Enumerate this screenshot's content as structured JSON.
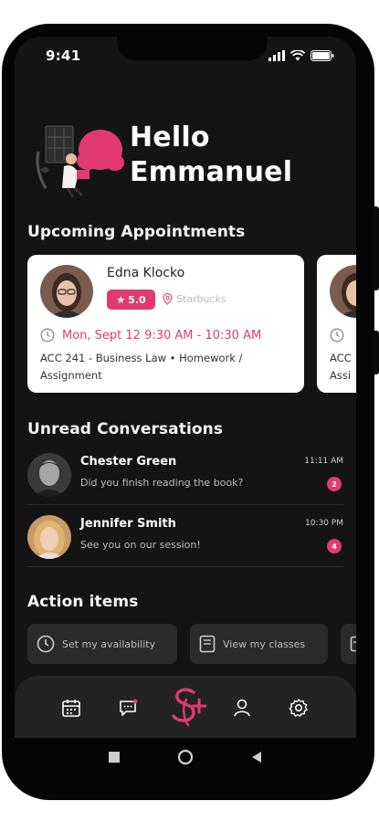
{
  "status_bar": {
    "time": "9:41"
  },
  "greeting": {
    "line1": "Hello",
    "line2": "Emmanuel"
  },
  "sections": {
    "appointments": "Upcoming Appointments",
    "unread": "Unread Conversations",
    "actions": "Action items"
  },
  "appointment": {
    "name": "Edna Klocko",
    "rating": "5.0",
    "location": "Starbucks",
    "datetime": "Mon, Sept 12 9:30 AM - 10:30 AM",
    "description": "ACC 241 - Business Law • Homework / Assignment",
    "peek_text": "ACC Assi"
  },
  "conversations": [
    {
      "name": "Chester Green",
      "message": "Did you finish reading the book?",
      "time": "11:11 AM",
      "unread": "2"
    },
    {
      "name": "Jennifer Smith",
      "message": "See you on our session!",
      "time": "10:30 PM",
      "unread": "4"
    }
  ],
  "action_items": [
    {
      "label": "Set my availability",
      "icon": "clock-icon"
    },
    {
      "label": "View my classes",
      "icon": "book-icon"
    }
  ],
  "nav": {
    "items": [
      "calendar-icon",
      "chat-icon",
      "logo",
      "profile-icon",
      "settings-icon"
    ],
    "accent": "#e23a70"
  },
  "colors": {
    "accent": "#e23a70",
    "background": "#141414",
    "card": "#ffffff"
  }
}
